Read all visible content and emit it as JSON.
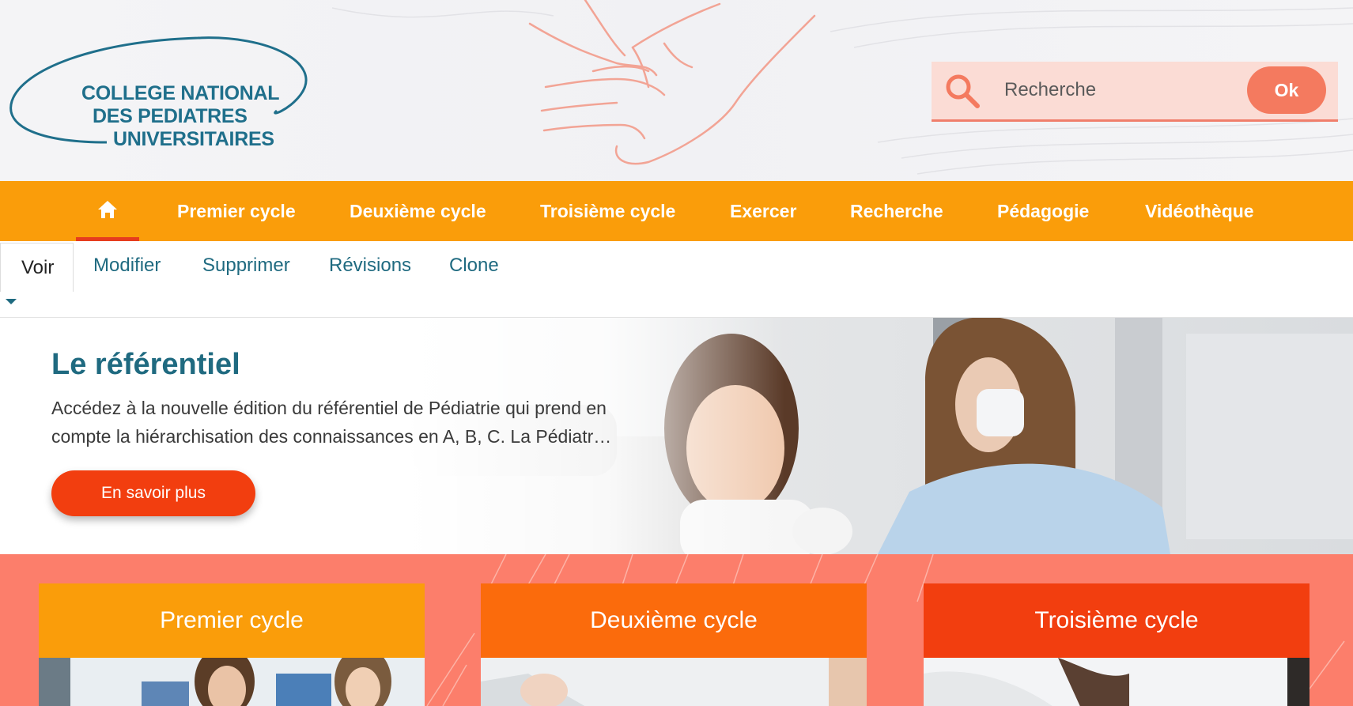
{
  "header": {
    "logo": {
      "line1": "COLLEGE NATIONAL",
      "line2": "DES PEDIATRES",
      "line3": "UNIVERSITAIRES",
      "color": "#1f6f8b"
    },
    "decoration": "hands-illustration",
    "search": {
      "placeholder": "Recherche",
      "value": "",
      "button_label": "Ok",
      "icon": "search-icon"
    }
  },
  "main_nav": {
    "background": "#fa9d0a",
    "home_icon": "home-icon",
    "items": [
      {
        "label": "Premier cycle"
      },
      {
        "label": "Deuxième cycle"
      },
      {
        "label": "Troisième cycle"
      },
      {
        "label": "Exercer"
      },
      {
        "label": "Recherche"
      },
      {
        "label": "Pédagogie"
      },
      {
        "label": "Vidéothèque"
      }
    ]
  },
  "local_tabs": {
    "active": "Voir",
    "items": [
      {
        "label": "Voir"
      },
      {
        "label": "Modifier"
      },
      {
        "label": "Supprimer"
      },
      {
        "label": "Révisions"
      },
      {
        "label": "Clone"
      }
    ]
  },
  "hero": {
    "title": "Le référentiel",
    "text": "Accédez à la nouvelle édition du référentiel de Pédiatrie qui prend en compte la hiérarchisation des connaissances en A, B, C. La Pédiatr…",
    "button_label": "En savoir plus",
    "image": "child-with-doctor-photo"
  },
  "cycles": {
    "background": "#fc7e6b",
    "cards": [
      {
        "title": "Premier cycle",
        "color": "#fa9d0a"
      },
      {
        "title": "Deuxième cycle",
        "color": "#fb6b0c"
      },
      {
        "title": "Troisième cycle",
        "color": "#f23e0f"
      }
    ]
  }
}
